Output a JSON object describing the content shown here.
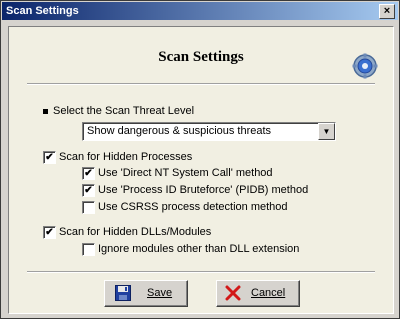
{
  "window": {
    "title": "Scan Settings",
    "close_glyph": "×"
  },
  "heading": "Scan Settings",
  "threat_level": {
    "label": "Select the Scan Threat Level",
    "selected": "Show dangerous & suspicious threats"
  },
  "hidden_processes": {
    "label": "Scan for Hidden Processes",
    "checked": true,
    "options": [
      {
        "label": "Use 'Direct NT System Call' method",
        "checked": true
      },
      {
        "label": "Use 'Process ID Bruteforce' (PIDB) method",
        "checked": true
      },
      {
        "label": "Use CSRSS process detection method",
        "checked": false
      }
    ]
  },
  "hidden_modules": {
    "label": "Scan for Hidden DLLs/Modules",
    "checked": true,
    "options": [
      {
        "label": "Ignore modules other than DLL extension",
        "checked": false
      }
    ]
  },
  "buttons": {
    "save_label": "Save",
    "cancel_label": "Cancel"
  },
  "icons": {
    "gear": "settings-gear-icon",
    "save": "floppy-disk-icon",
    "cancel": "red-x-icon"
  },
  "colors": {
    "title_start": "#0a246a",
    "title_end": "#a6caf0",
    "check": "#000000",
    "save_icon": "#1f3f9f",
    "cancel_icon": "#d21919"
  }
}
